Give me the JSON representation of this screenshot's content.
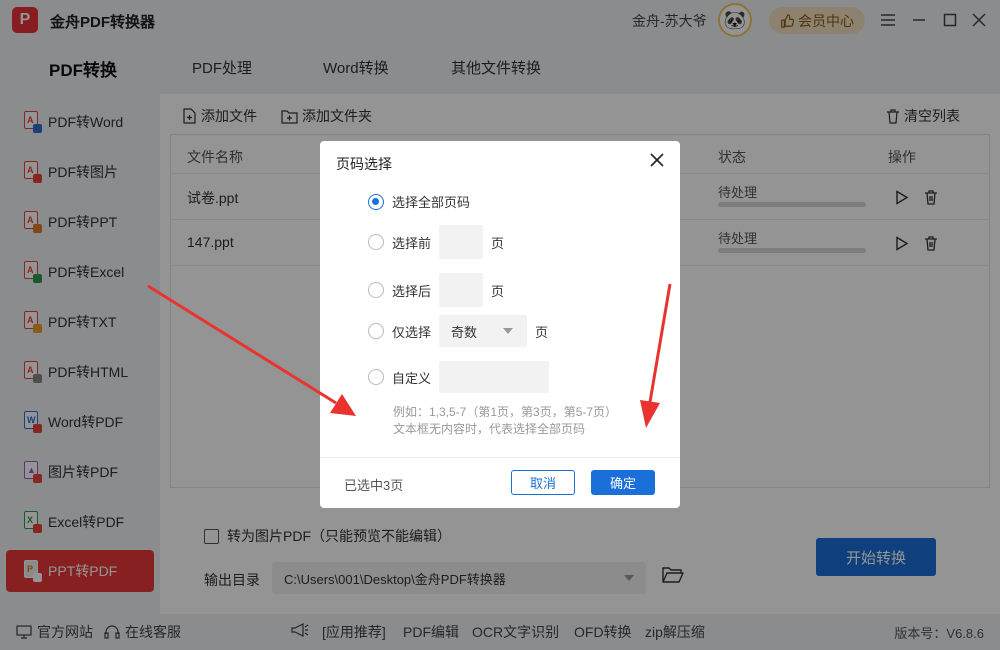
{
  "app": {
    "title": "金舟PDF转换器",
    "logo_text": "P"
  },
  "header": {
    "username": "金舟-苏大爷",
    "vip_label": "会员中心",
    "window_buttons": [
      "settings-icon",
      "minimize-icon",
      "maximize-icon",
      "close-icon"
    ]
  },
  "tabs": [
    {
      "label": "PDF转换"
    },
    {
      "label": "PDF处理"
    },
    {
      "label": "Word转换"
    },
    {
      "label": "其他文件转换"
    }
  ],
  "sidebar": {
    "items": [
      {
        "label": "PDF转Word"
      },
      {
        "label": "PDF转图片"
      },
      {
        "label": "PDF转PPT"
      },
      {
        "label": "PDF转Excel"
      },
      {
        "label": "PDF转TXT"
      },
      {
        "label": "PDF转HTML"
      },
      {
        "label": "Word转PDF"
      },
      {
        "label": "图片转PDF"
      },
      {
        "label": "Excel转PDF"
      },
      {
        "label": "PPT转PDF"
      }
    ]
  },
  "toolbar": {
    "add_file": "添加文件",
    "add_folder": "添加文件夹",
    "clear_list": "清空列表"
  },
  "table": {
    "headers": {
      "name": "文件名称",
      "status": "状态",
      "ops": "操作"
    },
    "rows": [
      {
        "name": "试卷.ppt",
        "status": "待处理",
        "progress": 0
      },
      {
        "name": "147.ppt",
        "status": "待处理",
        "progress": 0
      }
    ]
  },
  "options": {
    "to_image_pdf": "转为图片PDF（只能预览不能编辑）",
    "to_image_pdf_checked": false,
    "output_label": "输出目录",
    "output_path": "C:\\Users\\001\\Desktop\\金舟PDF转换器"
  },
  "start_button": "开始转换",
  "bottombar": {
    "website": "官方网站",
    "service": "在线客服",
    "links": [
      "[应用推荐]",
      "PDF编辑",
      "OCR文字识别",
      "OFD转换",
      "zip解压缩"
    ],
    "version": "版本号：V6.8.6"
  },
  "dialog": {
    "title": "页码选择",
    "option_all": "选择全部页码",
    "option_first": "选择前",
    "option_last": "选择后",
    "option_only": "仅选择",
    "option_custom": "自定义",
    "page_unit": "页",
    "only_selected": "奇数",
    "selected_option": "all",
    "hint_line1": "例如：1,3,5-7（第1页，第3页，第5-7页）",
    "hint_line2": "文本框无内容时，代表选择全部页码",
    "selected_count": "已选中3页",
    "cancel": "取消",
    "confirm": "确定"
  },
  "colors": {
    "accent": "#1a6fd8",
    "active_sidebar": "#e83a3a",
    "vip_bg": "#f3e0c0",
    "arrow": "#e8332f"
  }
}
